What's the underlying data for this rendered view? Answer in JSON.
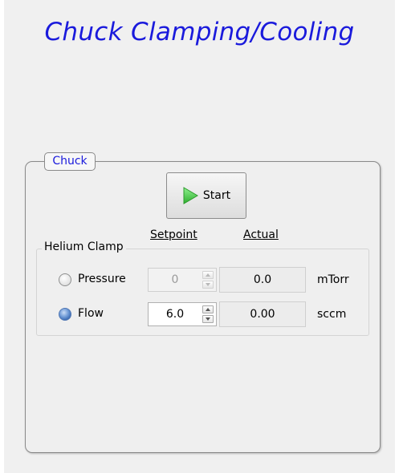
{
  "window": {
    "title": "Chuck Clamping/Cooling"
  },
  "chuck": {
    "tab_label": "Chuck",
    "start_button": {
      "label": "Start",
      "icon": "play-icon",
      "icon_color": "#3cc83c"
    },
    "columns": {
      "setpoint": "Setpoint",
      "actual": "Actual"
    },
    "helium_clamp": {
      "label": "Helium Clamp",
      "pressure": {
        "label": "Pressure",
        "selected": false,
        "setpoint": "0",
        "actual": "0.0",
        "unit": "mTorr",
        "enabled": false
      },
      "flow": {
        "label": "Flow",
        "selected": true,
        "setpoint": "6.0",
        "actual": "0.00",
        "unit": "sccm",
        "enabled": true
      }
    }
  },
  "colors": {
    "title": "#1a1adc",
    "tab_text": "#1a1adc",
    "background": "#f0f0f0"
  }
}
